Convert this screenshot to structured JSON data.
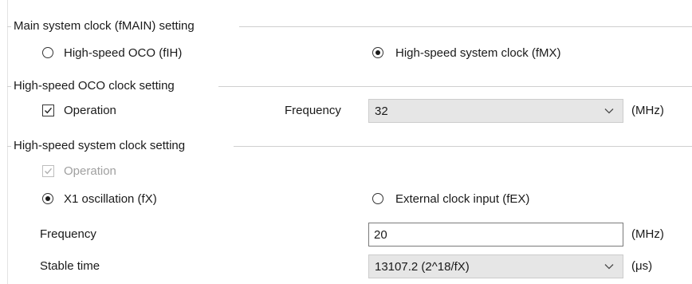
{
  "main_clock": {
    "title": "Main system clock (fMAIN) setting",
    "options": [
      {
        "label": "High-speed OCO (fIH)",
        "selected": false
      },
      {
        "label": "High-speed system clock (fMX)",
        "selected": true
      }
    ]
  },
  "oco_clock": {
    "title": "High-speed OCO clock setting",
    "operation_label": "Operation",
    "operation_checked": true,
    "frequency_label": "Frequency",
    "frequency_value": "32",
    "frequency_unit": "(MHz)"
  },
  "system_clock": {
    "title": "High-speed system clock setting",
    "operation_label": "Operation",
    "operation_checked": true,
    "operation_disabled": true,
    "options": [
      {
        "label": "X1 oscillation (fX)",
        "selected": true
      },
      {
        "label": "External clock input (fEX)",
        "selected": false
      }
    ],
    "frequency_label": "Frequency",
    "frequency_value": "20",
    "frequency_unit": "(MHz)",
    "stable_time_label": "Stable time",
    "stable_time_value": "13107.2 (2^18/fX)",
    "stable_time_unit": "(μs)"
  },
  "colors": {
    "group_line": "#cfcfcf",
    "disabled_text": "#a0a0a0",
    "combo_background": "#e6e6e6"
  },
  "icons": {
    "dropdown": "chevron-down-icon",
    "check": "checkmark-icon"
  }
}
